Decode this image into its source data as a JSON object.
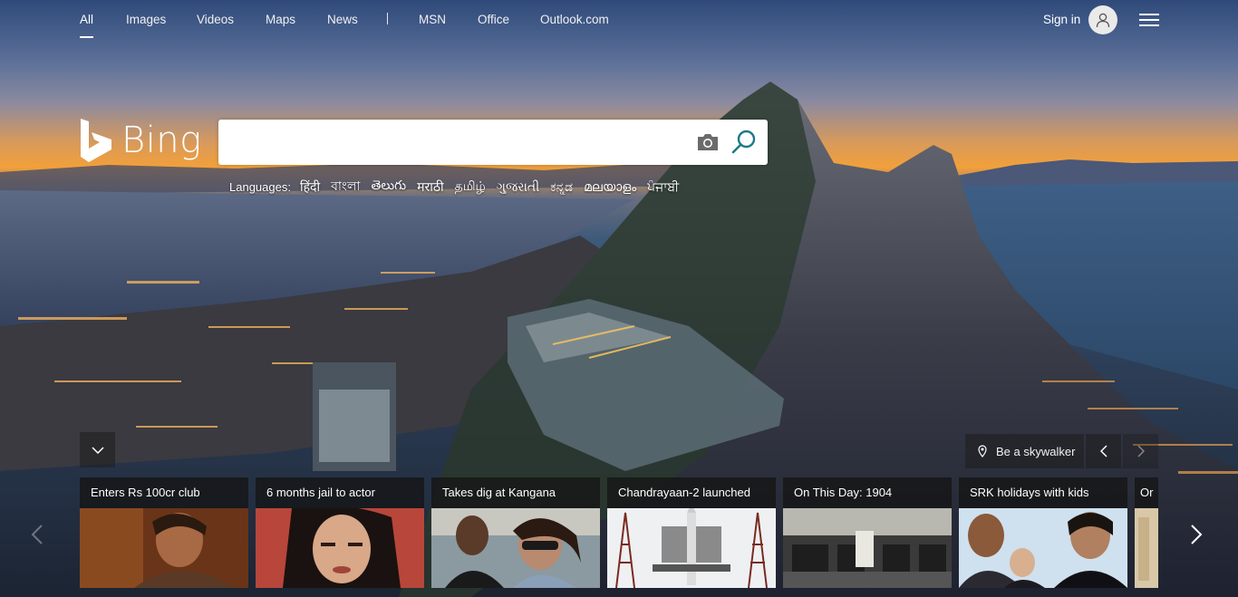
{
  "nav": {
    "items": [
      {
        "label": "All",
        "active": true
      },
      {
        "label": "Images"
      },
      {
        "label": "Videos"
      },
      {
        "label": "Maps"
      },
      {
        "label": "News"
      },
      {
        "label": "MSN"
      },
      {
        "label": "Office"
      },
      {
        "label": "Outlook.com"
      }
    ],
    "signin_label": "Sign in"
  },
  "logo": {
    "text": "Bing",
    "color": "#ffffff"
  },
  "search": {
    "value": "",
    "placeholder": ""
  },
  "languages": {
    "label": "Languages:",
    "items": [
      "हिंदी",
      "বাংলা",
      "తెలుగు",
      "मराठी",
      "தமிழ்",
      "ગુજરાતી",
      "ಕನ್ನಡ",
      "മലയാളം",
      "ਪੰਜਾਬੀ"
    ]
  },
  "image_info": {
    "label": "Be a skywalker"
  },
  "news": [
    {
      "caption": "Enters Rs 100cr club"
    },
    {
      "caption": "6 months jail to actor"
    },
    {
      "caption": "Takes dig at Kangana"
    },
    {
      "caption": "Chandrayaan-2 launched"
    },
    {
      "caption": "On This Day: 1904"
    },
    {
      "caption": "SRK holidays with kids"
    },
    {
      "caption": "Or"
    }
  ],
  "icons": {
    "avatar": "person-icon",
    "menu": "hamburger-icon",
    "camera": "camera-icon",
    "search": "search-icon",
    "collapse": "chevron-down-icon",
    "location": "location-pin-icon",
    "prev": "chevron-left-icon",
    "next": "chevron-right-icon"
  },
  "colors": {
    "search_icon": "#1d7a8a",
    "camera_icon": "#6b6b6b"
  }
}
